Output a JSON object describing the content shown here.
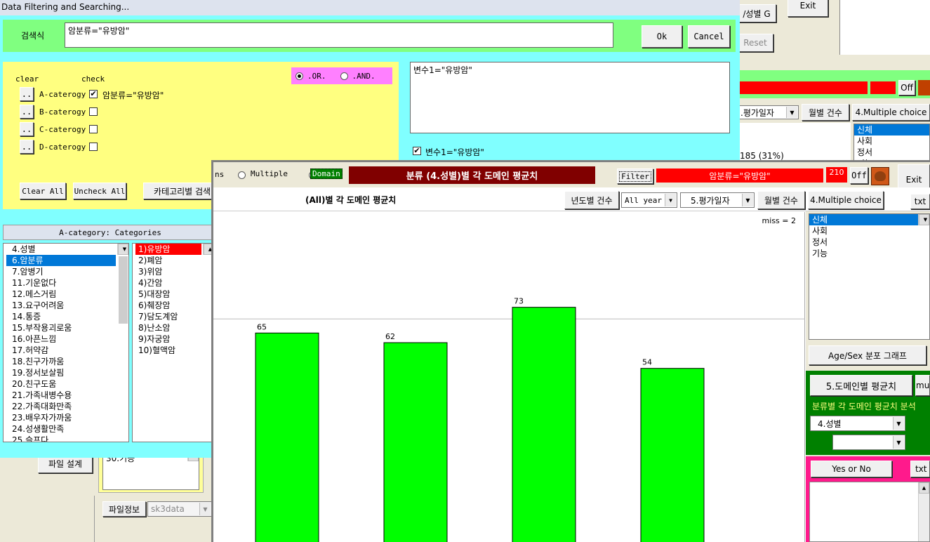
{
  "bg": {
    "exit_label": "Exit",
    "reset_label": "Reset",
    "sex_g_label": "/성별 G",
    "off_label": "Off",
    "date_select": ".평가일자",
    "month_count": "월별 건수",
    "multiple_choice": "4.Multiple choice",
    "domain_items": [
      "신체",
      "사회",
      "정서",
      "기능"
    ],
    "count_text": "185 (31%)",
    "file_setting": "파일 설계",
    "file_info": "파일정보",
    "file_name": "sk3data",
    "list_tail": "30.기능"
  },
  "filter": {
    "title": "Data Filtering and Searching...",
    "search_label": "검색식",
    "search_value": "암분류=\"유방암\"",
    "ok": "Ok",
    "cancel": "Cancel",
    "clear_hdr": "clear",
    "check_hdr": "check",
    "or_label": ".OR.",
    "and_label": ".AND.",
    "categories": [
      {
        "dots": "..",
        "name": "A-caterogy",
        "checked": "✔",
        "value": "암분류=\"유방암\""
      },
      {
        "dots": "..",
        "name": "B-caterogy",
        "checked": "",
        "value": ""
      },
      {
        "dots": "..",
        "name": "C-caterogy",
        "checked": "",
        "value": ""
      },
      {
        "dots": "..",
        "name": "D-caterogy",
        "checked": "",
        "value": ""
      }
    ],
    "clear_all": "Clear All",
    "uncheck_all": "Uncheck All",
    "cat_search": "카테고리별 검색",
    "var_text": "변수1=\"유방암\"",
    "var_check_label": "변수1=\"유방암\"",
    "var_checked": "✔",
    "cat_header": "A-category: Categories",
    "variables": [
      "4.성별",
      "6.암분류",
      "7.암병기",
      "11.기운없다",
      "12.메스거림",
      "13.요구어려움",
      "14.통증",
      "15.부작용괴로움",
      "16.아픈느낌",
      "17.허약감",
      "18.친구가까움",
      "19.정서보살핌",
      "20.친구도움",
      "21.가족내병수용",
      "22.가족대화만족",
      "23.배우자가까움",
      "24.성생활만족",
      "25.슬프다"
    ],
    "values": [
      "1)유방암",
      "2)폐암",
      "3)위암",
      "4)간암",
      "5)대장암",
      "6)췌장암",
      "7)담도계암",
      "8)난소암",
      "9)자궁암",
      "10)혈액암"
    ]
  },
  "main": {
    "radio_prefix": "ns",
    "radio_multiple": "Multiple",
    "radio_domain": "Domain",
    "title": "분류 (4.성별)별 각 도메인 평균치",
    "filter_btn": "Filter",
    "filter_value": "암분류=\"유방암\"",
    "count": "210",
    "off": "Off",
    "exit": "Exit",
    "txt": "txt",
    "subtitle": "(All)별 각 도메인 평균치",
    "year_count": "년도별 건수",
    "year_select": "All year",
    "date_select": "5.평가일자",
    "month_count": "월별 건수",
    "multiple_choice": "4.Multiple choice",
    "domain_items": [
      "신체",
      "사회",
      "정서",
      "기능"
    ],
    "age_sex": "Age/Sex 분포 그래프",
    "domain_avg": "5.도메인별 평균치",
    "mu": "mu",
    "cls_label": "분류별 각 도메인 평균치 분석",
    "cls_select": "4.성별",
    "cls_select2": "",
    "yes_no": "Yes or No",
    "txt2": "txt",
    "miss": "miss = 2"
  },
  "chart_data": {
    "type": "bar",
    "categories": [
      "",
      "",
      "",
      ""
    ],
    "values": [
      65,
      62,
      73,
      54
    ],
    "color": "#00ff00"
  }
}
